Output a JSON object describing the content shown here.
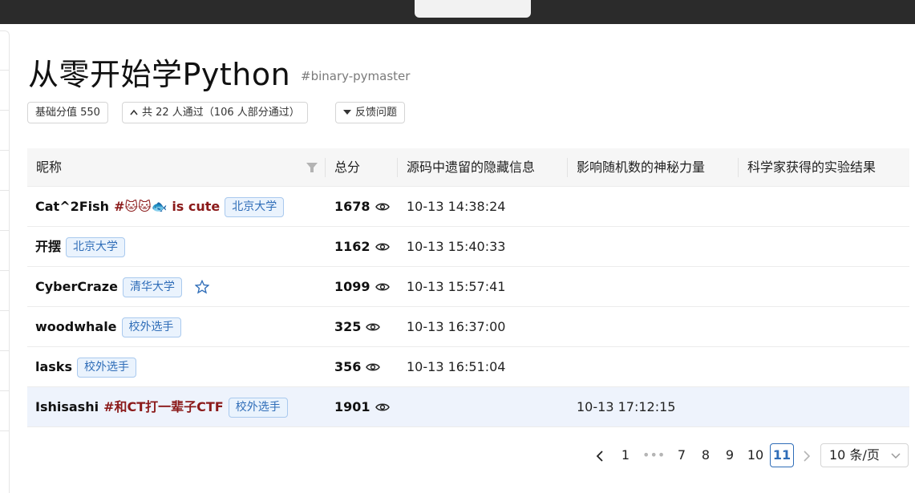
{
  "problem": {
    "title": "从零开始学Python",
    "slug": "#binary-pymaster",
    "base_score": "基础分值 550",
    "pass_info": "共 22 人通过（106 人部分通过）",
    "feedback": "反馈问题"
  },
  "table": {
    "headers": {
      "nickname": "昵称",
      "total": "总分",
      "flag1": "源码中遗留的隐藏信息",
      "flag2": "影响随机数的神秘力量",
      "flag3": "科学家获得的实验结果"
    },
    "rows": [
      {
        "nick": "Cat^2Fish",
        "motto": "#🐱🐱🐟 is cute",
        "org": "北京大学",
        "score": "1678",
        "flag1": "10-13 14:38:24",
        "flag2": "",
        "star": false
      },
      {
        "nick": "开摆",
        "motto": "",
        "org": "北京大学",
        "score": "1162",
        "flag1": "10-13 15:40:33",
        "flag2": "",
        "star": false
      },
      {
        "nick": "CyberCraze",
        "motto": "",
        "org": "清华大学",
        "score": "1099",
        "flag1": "10-13 15:57:41",
        "flag2": "",
        "star": true
      },
      {
        "nick": "woodwhale",
        "motto": "",
        "org": "校外选手",
        "score": "325",
        "flag1": "10-13 16:37:00",
        "flag2": "",
        "star": false
      },
      {
        "nick": "lasks",
        "motto": "",
        "org": "校外选手",
        "score": "356",
        "flag1": "10-13 16:51:04",
        "flag2": "",
        "star": false
      },
      {
        "nick": "Ishisashi",
        "motto": "#和CT打一辈子CTF",
        "org": "校外选手",
        "score": "1901",
        "flag1": "",
        "flag2": "10-13 17:12:15",
        "star": false
      }
    ]
  },
  "pagination": {
    "prev": "‹",
    "pages": [
      "1",
      "•••",
      "7",
      "8",
      "9",
      "10",
      "11"
    ],
    "current": "11",
    "next": "›",
    "page_size": "10 条/页"
  },
  "colors": {
    "accent": "#2f6db8",
    "motto": "#8b1a1a",
    "highlight_row": "#eef3fc"
  }
}
